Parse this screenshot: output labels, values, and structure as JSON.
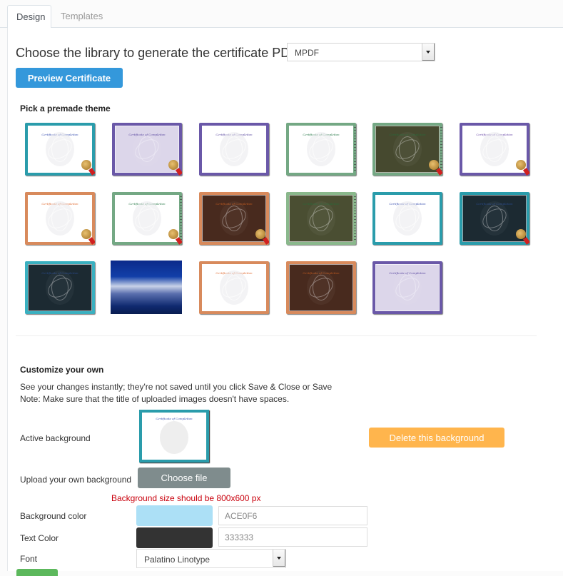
{
  "tabs": [
    {
      "label": "Design",
      "active": true
    },
    {
      "label": "Templates",
      "active": false
    }
  ],
  "library": {
    "label": "Choose the library to generate the certificate PDF",
    "selected": "MPDF"
  },
  "preview_button": "Preview Certificate",
  "premade": {
    "title": "Pick a premade theme",
    "themes": [
      {
        "name": "teal-white",
        "border": "#2a9cab",
        "bg": "#ffffff",
        "title_color": "#3a50b0",
        "seal": true,
        "spine": false
      },
      {
        "name": "purple-lavender",
        "border": "#6a58a8",
        "bg": "#dcd6ea",
        "title_color": "#5a48a0",
        "seal": true,
        "spine": false
      },
      {
        "name": "purple-white",
        "border": "#6a58a8",
        "bg": "#ffffff",
        "title_color": "#5a48a0",
        "seal": false,
        "spine": false
      },
      {
        "name": "green-white",
        "border": "#74a884",
        "bg": "#ffffff",
        "title_color": "#2a7a4a",
        "seal": false,
        "spine": true
      },
      {
        "name": "green-dark",
        "border": "#74a884",
        "bg": "#46492f",
        "title_color": "#2a6a3a",
        "seal": true,
        "spine": true
      },
      {
        "name": "purple-white-seal",
        "border": "#6a58a8",
        "bg": "#ffffff",
        "title_color": "#6a48a8",
        "seal": true,
        "spine": false
      },
      {
        "name": "orange-white",
        "border": "#d88a5c",
        "bg": "#ffffff",
        "title_color": "#e06a30",
        "seal": true,
        "spine": false
      },
      {
        "name": "green-white-seal",
        "border": "#74a884",
        "bg": "#ffffff",
        "title_color": "#2a7a4a",
        "seal": true,
        "spine": true
      },
      {
        "name": "orange-brown",
        "border": "#d88a5c",
        "bg": "#482a1e",
        "title_color": "#c05a20",
        "seal": true,
        "spine": false
      },
      {
        "name": "green-olive",
        "border": "#8ab88c",
        "bg": "#4a4e32",
        "title_color": "#2a6a3a",
        "seal": false,
        "spine": true
      },
      {
        "name": "teal-white-2",
        "border": "#2a9cab",
        "bg": "#ffffff",
        "title_color": "#3a50b0",
        "seal": false,
        "spine": false
      },
      {
        "name": "teal-dark",
        "border": "#2a9cab",
        "bg": "#1c2a32",
        "title_color": "#2a4a8a",
        "seal": true,
        "spine": false
      },
      {
        "name": "teal-dark-2",
        "border": "#3ab0c0",
        "bg": "#1c2a32",
        "title_color": "#2a4a8a",
        "seal": false,
        "spine": false
      },
      {
        "name": "blue-forest-photo",
        "photo": true
      },
      {
        "name": "orange-white-2",
        "border": "#d88a5c",
        "bg": "#ffffff",
        "title_color": "#e06a30",
        "seal": false,
        "spine": false
      },
      {
        "name": "orange-brown-2",
        "border": "#d88a5c",
        "bg": "#482a1e",
        "title_color": "#c05a20",
        "seal": false,
        "spine": false
      },
      {
        "name": "purple-lavender-2",
        "border": "#6a58a8",
        "bg": "#dcd6ea",
        "title_color": "#5a48a0",
        "seal": false,
        "spine": false
      }
    ],
    "thumb_title": "Certificate of Completion"
  },
  "customize": {
    "title": "Customize your own",
    "note1": "See your changes instantly; they're not saved until you click Save & Close or Save",
    "note2": "Note: Make sure that the title of uploaded images doesn't have spaces.",
    "active_background_label": "Active background",
    "delete_button": "Delete this background",
    "upload_label": "Upload your own background",
    "choose_file_button": "Choose file",
    "size_hint": "Background size should be 800x600 px",
    "background_color_label": "Background color",
    "background_color_value": "ACE0F6",
    "background_color_swatch": "#ace0f6",
    "text_color_label": "Text Color",
    "text_color_value": "333333",
    "text_color_swatch": "#333333",
    "font_label": "Font",
    "font_selected": "Palatino Linotype"
  }
}
